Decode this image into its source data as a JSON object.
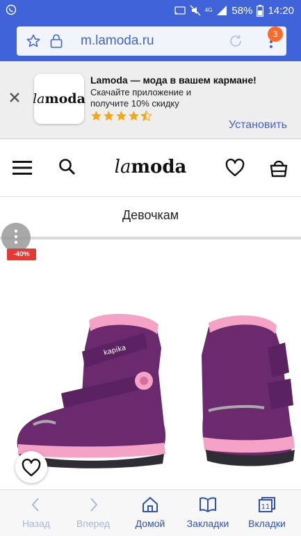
{
  "statusbar": {
    "battery_percent": "58%",
    "time": "14:20",
    "network": "4G"
  },
  "browser": {
    "url": "m.lamoda.ru",
    "tabs_badge": "3"
  },
  "banner": {
    "logo": "lamoda",
    "title": "Lamoda — мода в вашем кармане!",
    "description": "Скачайте приложение и получите 10% скидку",
    "rating_stars": 4.5,
    "install_label": "Установить"
  },
  "header": {
    "logo": "lamoda"
  },
  "category": {
    "label": "Девочкам"
  },
  "product": {
    "discount": "-40%",
    "brand_on_shoe": "kapika"
  },
  "bottom_nav": {
    "items": [
      {
        "label": "Назад",
        "icon": "chevron-left-icon"
      },
      {
        "label": "Вперед",
        "icon": "chevron-right-icon"
      },
      {
        "label": "Домой",
        "icon": "home-icon"
      },
      {
        "label": "Закладки",
        "icon": "book-icon"
      },
      {
        "label": "Вкладки",
        "icon": "tabs-icon"
      }
    ],
    "tabs_count": "11"
  },
  "colors": {
    "brand_blue": "#3f63d8",
    "badge_orange": "#ff6a2a",
    "discount_red": "#e53935",
    "star_gold": "#f2a81d",
    "boot_purple": "#6b2a6e",
    "boot_pink": "#f4a3c6"
  }
}
